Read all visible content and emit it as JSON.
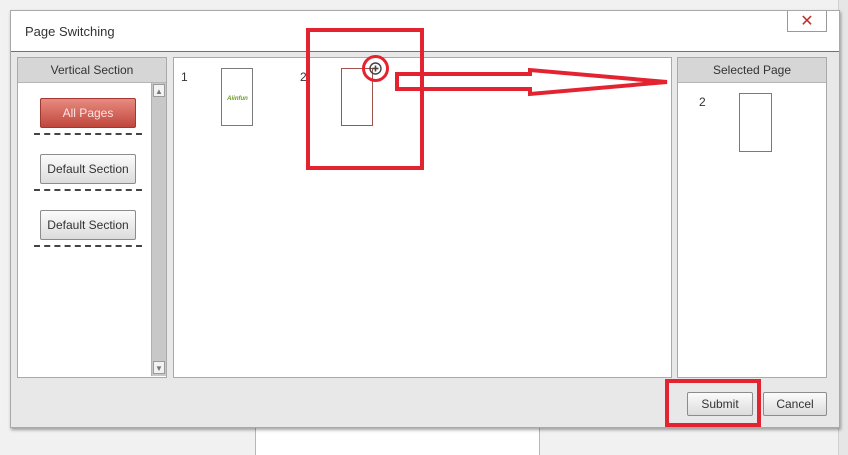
{
  "dialog": {
    "title": "Page Switching",
    "close_glyph": "✕"
  },
  "sections_panel": {
    "header": "Vertical Section",
    "buttons": [
      {
        "label": "All Pages",
        "active": true
      },
      {
        "label": "Default Section",
        "active": false
      },
      {
        "label": "Default Section",
        "active": false
      }
    ],
    "scroll_up_glyph": "▲",
    "scroll_down_glyph": "▼"
  },
  "pages_panel": {
    "pages": [
      {
        "number": "1",
        "thumbnail_logo": "Aiinfun",
        "selected": false
      },
      {
        "number": "2",
        "selected": true
      }
    ],
    "add_icon_glyph": "⊕"
  },
  "selected_panel": {
    "header": "Selected Page",
    "pages": [
      {
        "number": "2"
      }
    ]
  },
  "footer": {
    "submit_label": "Submit",
    "cancel_label": "Cancel"
  },
  "annotation": {
    "color": "#e3232f"
  },
  "colors": {
    "accent": "#c0473d",
    "title_underline": "#c0504d"
  }
}
